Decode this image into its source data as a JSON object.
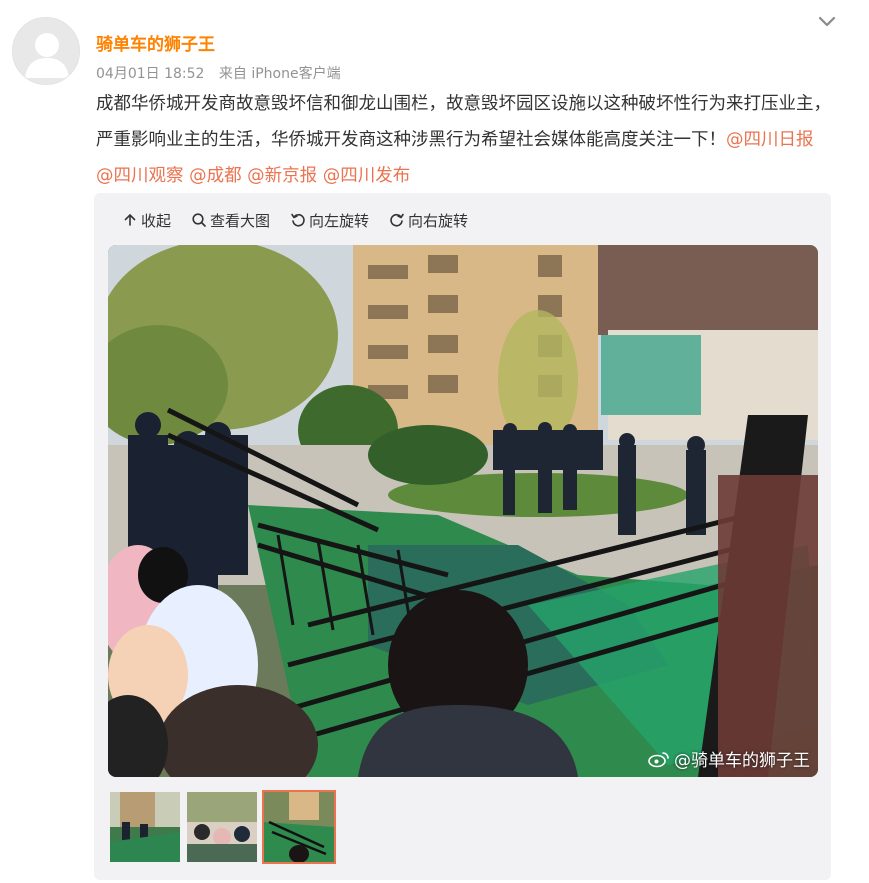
{
  "post": {
    "author": "骑单车的狮子王",
    "date": "04月01日 18:52",
    "source": "来自 iPhone客户端",
    "text_main": "成都华侨城开发商故意毁坏信和御龙山围栏，故意毁坏园区设施以这种破坏性行为来打压业主，严重影响业主的生活，华侨城开发商这种涉黑行为希望社会媒体能高度关注一下！",
    "mentions": [
      "@四川日报",
      "@四川观察",
      "@成都",
      "@新京报",
      "@四川发布"
    ]
  },
  "toolbar": {
    "collapse": "收起",
    "view_large": "查看大图",
    "rotate_left": "向左旋转",
    "rotate_right": "向右旋转"
  },
  "image": {
    "watermark": "@骑单车的狮子王"
  },
  "thumbnails": {
    "count": 3,
    "selected_index": 2
  },
  "colors": {
    "accent": "#ff8200",
    "mention": "#eb7350",
    "meta": "#939393"
  },
  "icons": [
    "chevron-down-icon",
    "collapse-arrow-icon",
    "magnifier-icon",
    "rotate-left-icon",
    "rotate-right-icon",
    "weibo-logo-icon"
  ]
}
